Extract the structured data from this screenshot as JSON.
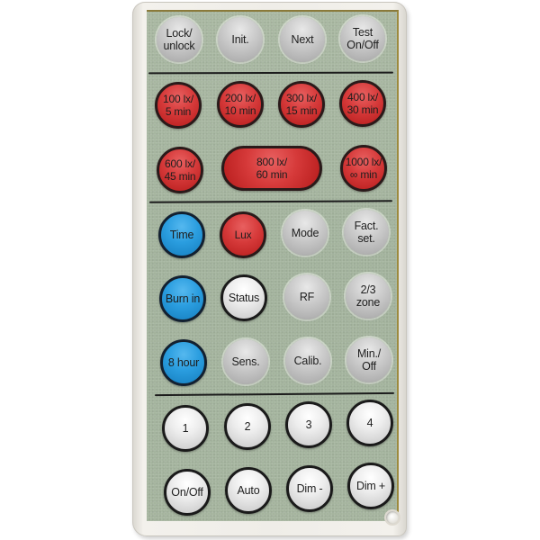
{
  "device": {
    "name": "Remote control",
    "colors": {
      "panel": "#a7b59f",
      "casing": "#efede8",
      "red": "#d63a3a",
      "blue": "#2a9ddf",
      "grey": "#c4c4c4",
      "white": "#e8e8e8",
      "divider": "#1c1c1c"
    }
  },
  "sections": {
    "top": {
      "buttons": [
        {
          "label": "Lock/\nunlock",
          "style": "grey"
        },
        {
          "label": "Init.",
          "style": "grey"
        },
        {
          "label": "Next",
          "style": "grey"
        },
        {
          "label": "Test\nOn/Off",
          "style": "grey"
        }
      ]
    },
    "presets": {
      "buttons": [
        {
          "label": "100 lx/\n5 min",
          "style": "red"
        },
        {
          "label": "200 lx/\n10 min",
          "style": "red"
        },
        {
          "label": "300 lx/\n15 min",
          "style": "red"
        },
        {
          "label": "400 lx/\n30 min",
          "style": "red"
        },
        {
          "label": "600 lx/\n45 min",
          "style": "red"
        },
        {
          "label": "800 lx/\n60 min",
          "style": "red-pill"
        },
        {
          "label": "1000 lx/\n∞ min",
          "style": "red"
        }
      ]
    },
    "settings": {
      "buttons": [
        {
          "label": "Time",
          "style": "blue"
        },
        {
          "label": "Lux",
          "style": "red"
        },
        {
          "label": "Mode",
          "style": "grey"
        },
        {
          "label": "Fact.\nset.",
          "style": "grey"
        },
        {
          "label": "Burn in",
          "style": "blue"
        },
        {
          "label": "Status",
          "style": "white"
        },
        {
          "label": "RF",
          "style": "grey"
        },
        {
          "label": "2/3\nzone",
          "style": "grey"
        },
        {
          "label": "8 hour",
          "style": "blue"
        },
        {
          "label": "Sens.",
          "style": "grey"
        },
        {
          "label": "Calib.",
          "style": "grey"
        },
        {
          "label": "Min./\nOff",
          "style": "grey"
        }
      ]
    },
    "control": {
      "buttons": [
        {
          "label": "1",
          "style": "white"
        },
        {
          "label": "2",
          "style": "white"
        },
        {
          "label": "3",
          "style": "white"
        },
        {
          "label": "4",
          "style": "white"
        },
        {
          "label": "On/Off",
          "style": "white"
        },
        {
          "label": "Auto",
          "style": "white"
        },
        {
          "label": "Dim -",
          "style": "white"
        },
        {
          "label": "Dim +",
          "style": "white"
        }
      ]
    }
  }
}
